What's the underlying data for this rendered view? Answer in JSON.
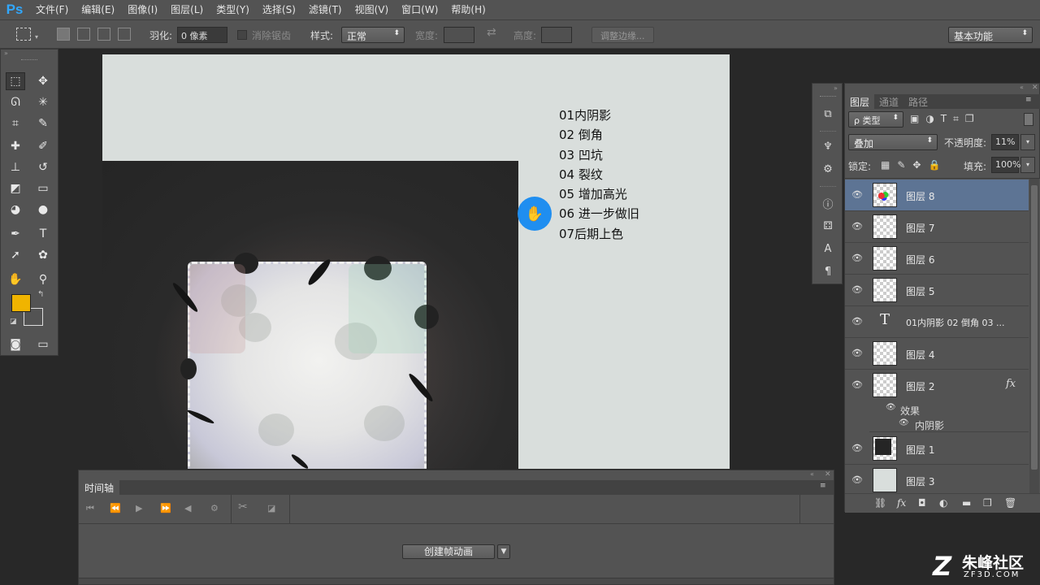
{
  "app": {
    "logo": "Ps"
  },
  "menu": [
    "文件(F)",
    "编辑(E)",
    "图像(I)",
    "图层(L)",
    "类型(Y)",
    "选择(S)",
    "滤镜(T)",
    "视图(V)",
    "窗口(W)",
    "帮助(H)"
  ],
  "options": {
    "feather_label": "羽化:",
    "feather_value": "0 像素",
    "antialias_label": "消除锯齿",
    "style_label": "样式:",
    "style_value": "正常",
    "width_label": "宽度:",
    "height_label": "高度:",
    "refine_edge": "调整边缘...",
    "workspace": "基本功能"
  },
  "canvas": {
    "text_lines": [
      "01内阴影",
      "02 倒角",
      "03 凹坑",
      "04 裂纹",
      "05 增加高光",
      "06 进一步做旧",
      "07后期上色"
    ],
    "cursor_icon": "hand-icon"
  },
  "layers_panel": {
    "tabs": [
      "图层",
      "通道",
      "路径"
    ],
    "filter_label": "ρ 类型",
    "blend_mode": "叠加",
    "opacity_label": "不透明度:",
    "opacity_value": "11%",
    "lock_label": "锁定:",
    "fill_label": "填充:",
    "fill_value": "100%",
    "layers": [
      {
        "name": "图层 8",
        "selected": true
      },
      {
        "name": "图层 7"
      },
      {
        "name": "图层 6"
      },
      {
        "name": "图层 5"
      },
      {
        "name": "01内阴影 02 倒角 03 ...",
        "type": "text"
      },
      {
        "name": "图层 4"
      },
      {
        "name": "图层 2",
        "fx": "fx"
      },
      {
        "name": "图层 1"
      },
      {
        "name": "图层 3"
      }
    ],
    "effects_label": "效果",
    "effect_item": "内阴影",
    "text_layer_glyph": "T"
  },
  "timeline": {
    "title": "时间轴",
    "create_button": "创建帧动画"
  },
  "watermark": {
    "brand": "朱峰社区",
    "url": "ZF3D.COM"
  },
  "colors": {
    "foreground": "#f0b400",
    "background": "#ffffff",
    "accent": "#1f8ef0",
    "selected_layer": "#5d7494"
  }
}
